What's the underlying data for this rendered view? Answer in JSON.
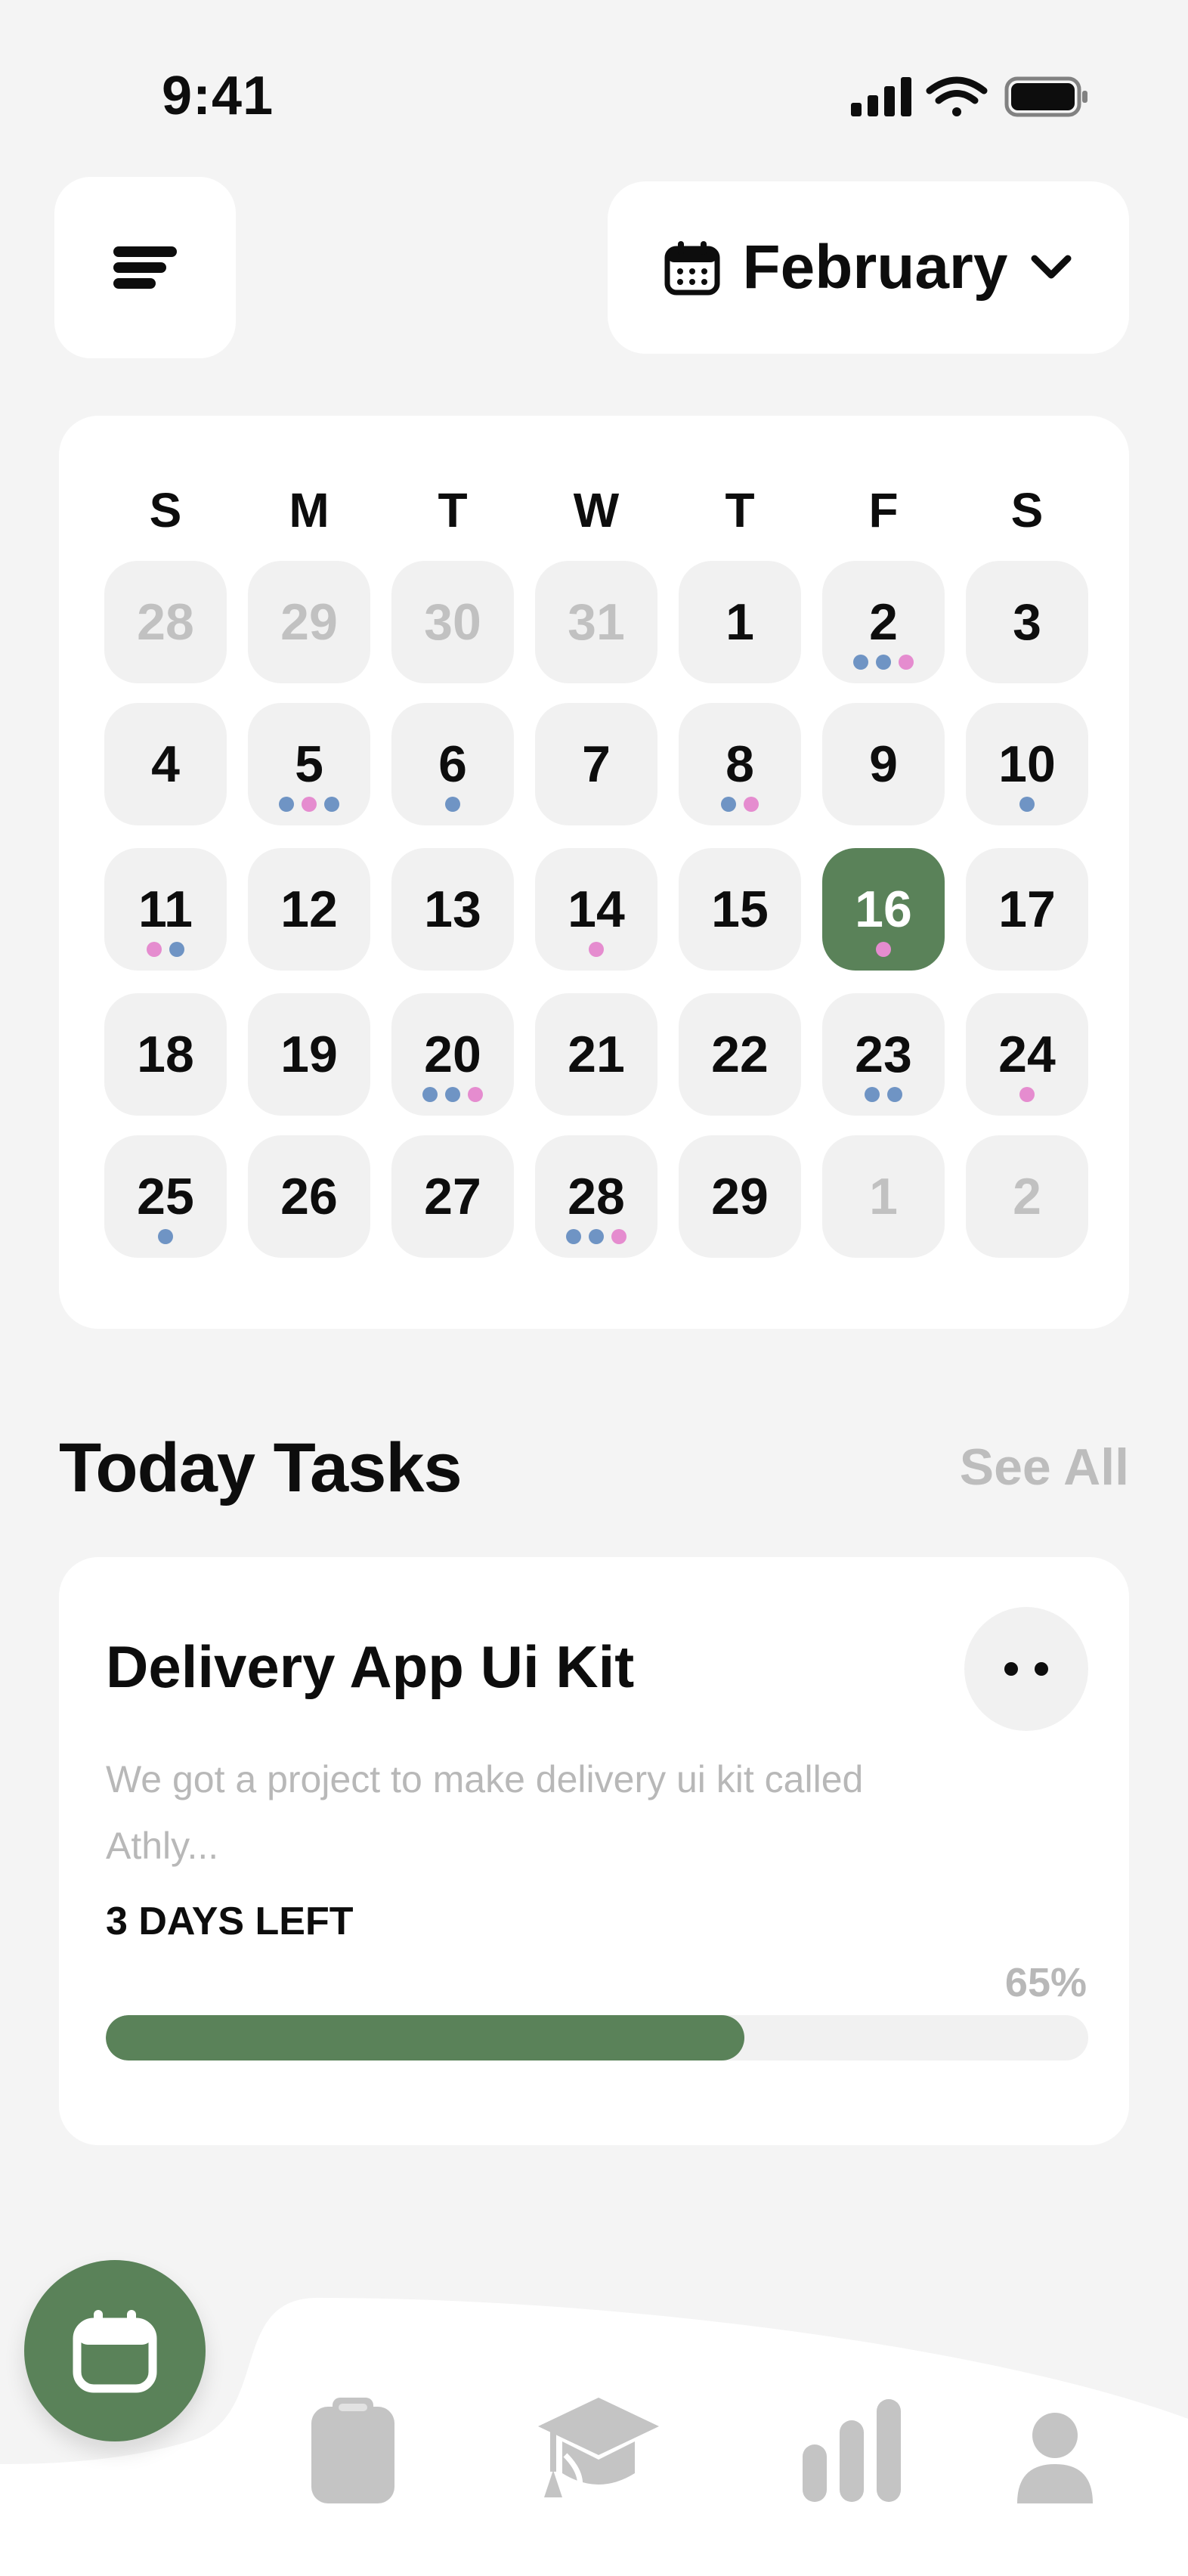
{
  "status_bar": {
    "time": "9:41"
  },
  "header": {
    "month": "February"
  },
  "calendar": {
    "weekdays": [
      "S",
      "M",
      "T",
      "W",
      "T",
      "F",
      "S"
    ],
    "weeks": [
      [
        {
          "label": "28",
          "muted": true,
          "dots": []
        },
        {
          "label": "29",
          "muted": true,
          "dots": []
        },
        {
          "label": "30",
          "muted": true,
          "dots": []
        },
        {
          "label": "31",
          "muted": true,
          "dots": []
        },
        {
          "label": "1",
          "dots": []
        },
        {
          "label": "2",
          "dots": [
            "blue",
            "blue",
            "pink"
          ]
        },
        {
          "label": "3",
          "dots": []
        }
      ],
      [
        {
          "label": "4",
          "dots": []
        },
        {
          "label": "5",
          "dots": [
            "blue",
            "pink",
            "blue"
          ]
        },
        {
          "label": "6",
          "dots": [
            "blue"
          ]
        },
        {
          "label": "7",
          "dots": []
        },
        {
          "label": "8",
          "dots": [
            "blue",
            "pink"
          ]
        },
        {
          "label": "9",
          "dots": []
        },
        {
          "label": "10",
          "dots": [
            "blue"
          ]
        }
      ],
      [
        {
          "label": "11",
          "dots": [
            "pink",
            "blue"
          ]
        },
        {
          "label": "12",
          "dots": []
        },
        {
          "label": "13",
          "dots": []
        },
        {
          "label": "14",
          "dots": [
            "pink"
          ]
        },
        {
          "label": "15",
          "dots": []
        },
        {
          "label": "16",
          "selected": true,
          "dots": [
            "pink"
          ]
        },
        {
          "label": "17",
          "dots": []
        }
      ],
      [
        {
          "label": "18",
          "dots": []
        },
        {
          "label": "19",
          "dots": []
        },
        {
          "label": "20",
          "dots": [
            "blue",
            "blue",
            "pink"
          ]
        },
        {
          "label": "21",
          "dots": []
        },
        {
          "label": "22",
          "dots": []
        },
        {
          "label": "23",
          "dots": [
            "blue",
            "blue"
          ]
        },
        {
          "label": "24",
          "dots": [
            "pink"
          ]
        }
      ],
      [
        {
          "label": "25",
          "dots": [
            "blue"
          ]
        },
        {
          "label": "26",
          "dots": []
        },
        {
          "label": "27",
          "dots": []
        },
        {
          "label": "28",
          "dots": [
            "blue",
            "blue",
            "pink"
          ]
        },
        {
          "label": "29",
          "dots": []
        },
        {
          "label": "1",
          "muted": true,
          "dots": []
        },
        {
          "label": "2",
          "muted": true,
          "dots": []
        }
      ]
    ]
  },
  "today_tasks": {
    "title": "Today Tasks",
    "see_all": "See All",
    "task": {
      "title": "Delivery App Ui Kit",
      "description": "We got a project to make delivery ui kit called Athly...",
      "deadline": "3 DAYS LEFT",
      "progress_label": "65%",
      "progress": 0.65
    }
  },
  "bottom_nav": {
    "items": [
      "calendar-icon",
      "clipboard-icon",
      "graduation-cap-icon",
      "bar-chart-icon",
      "user-icon"
    ],
    "active": "calendar-icon"
  },
  "colors": {
    "accent": "#5a8259",
    "dot_blue": "#6f94c4",
    "dot_pink": "#e58ccf",
    "muted_text": "#b8b8b8",
    "background": "#f4f4f4",
    "nav_icon": "#c4c4c4"
  }
}
